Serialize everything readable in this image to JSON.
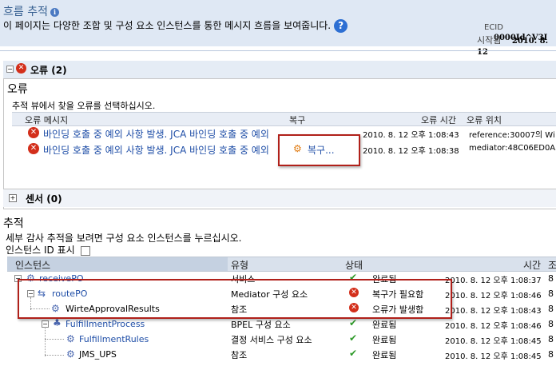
{
  "header": {
    "title": "흐름 추적",
    "description": "이 페이지는 다양한 조합 및 구성 요소 인스턴스를 통한 메시지 흐름을 보여줍니다.",
    "ecid_label": "ECID",
    "ecid_value": "0000Id^V3I",
    "started_label": "시작됨",
    "started_value": "2010. 8. 12"
  },
  "errors_panel": {
    "header": "오류 (2)",
    "section_title": "오류",
    "instruction": "추적 뷰에서 찾을 오류를 선택하십시오.",
    "columns": {
      "message": "오류 메시지",
      "recovery": "복구",
      "time": "오류 시간",
      "location": "오류 위치"
    },
    "rows": [
      {
        "message": "바인딩 호출 중 예외 사항 발생. JCA 바인딩 호출 중 예외",
        "recovery": "",
        "time": "2010. 8. 12 오후 1:08:43",
        "location": "reference:30007의 Wi"
      },
      {
        "message": "바인딩 호출 중 예외 사항 발생. JCA 바인딩 호출 중 예외",
        "recovery": "복구...",
        "time": "2010. 8. 12 오후 1:08:38",
        "location": "mediator:48C06ED0A5"
      }
    ]
  },
  "sensors": {
    "label": "센서 (0)"
  },
  "trace": {
    "section_title": "추적",
    "instruction": "세부 감사 추적을 보려면 구성 요소 인스턴스를 누르십시오.",
    "show_id_label": "인스턴스 ID 표시",
    "columns": {
      "instance": "인스턴스",
      "type": "유형",
      "state": "상태",
      "time": "시간",
      "extra": "조"
    },
    "rows": [
      {
        "name": "receivePO",
        "type": "서비스",
        "state": "완료됨",
        "state_icon": "check",
        "time": "2010. 8. 12 오후 1:08:37",
        "extra": "8"
      },
      {
        "name": "routePO",
        "type": "Mediator 구성 요소",
        "state": "복구가 필요함",
        "state_icon": "error",
        "time": "2010. 8. 12 오후 1:08:46",
        "extra": "8"
      },
      {
        "name": "WirteApprovalResults",
        "type": "참조",
        "state": "오류가 발생함",
        "state_icon": "error",
        "time": "2010. 8. 12 오후 1:08:43",
        "extra": "8"
      },
      {
        "name": "FulfillmentProcess",
        "type": "BPEL 구성 요소",
        "state": "완료됨",
        "state_icon": "check",
        "time": "2010. 8. 12 오후 1:08:46",
        "extra": "8"
      },
      {
        "name": "FulfillmentRules",
        "type": "결정 서비스 구성 요소",
        "state": "완료됨",
        "state_icon": "check",
        "time": "2010. 8. 12 오후 1:08:45",
        "extra": "8"
      },
      {
        "name": "JMS_UPS",
        "type": "참조",
        "state": "완료됨",
        "state_icon": "check",
        "time": "2010. 8. 12 오후 1:08:45",
        "extra": "8"
      }
    ]
  },
  "colors": {
    "accent": "#365f91",
    "link": "#1f4ea7",
    "error": "#d32f1b",
    "success": "#2f9a2a",
    "highlight": "#b0201a"
  }
}
